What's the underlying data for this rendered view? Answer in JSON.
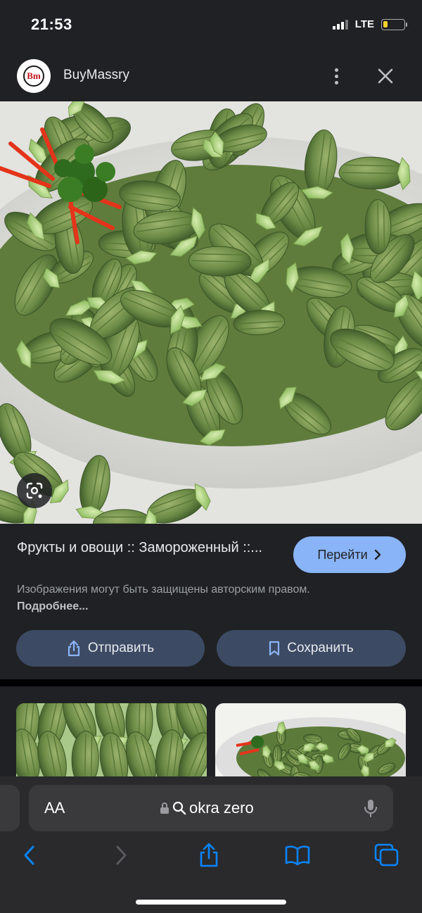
{
  "status": {
    "time": "21:53",
    "network": "LTE",
    "battery_level": 0.2
  },
  "header": {
    "logo_text": "Bm",
    "site_name": "BuyMassry"
  },
  "result": {
    "title": "Фрукты и овощи :: Замороженный ::...",
    "visit_label": "Перейти",
    "copyright_text": "Изображения могут быть защищены авторским правом.",
    "learn_more": "Подробнее..."
  },
  "actions": {
    "share_label": "Отправить",
    "save_label": "Сохранить"
  },
  "safari": {
    "text_size_label": "AA",
    "url": "okra zero"
  },
  "colors": {
    "accent": "#8ab4f8",
    "action_bg": "#3c4a63",
    "battery": "#f5d02e"
  },
  "icons": {
    "more": "more-vert-icon",
    "close": "close-icon",
    "lens": "lens-icon",
    "visit": "chevron-right-icon",
    "share": "share-icon",
    "save": "bookmark-icon",
    "lock": "lock-icon",
    "search": "search-icon",
    "mic": "mic-icon",
    "back": "back-icon",
    "forward": "forward-icon",
    "safari_share": "share-icon",
    "bookmarks": "book-icon",
    "tabs": "tabs-icon"
  }
}
